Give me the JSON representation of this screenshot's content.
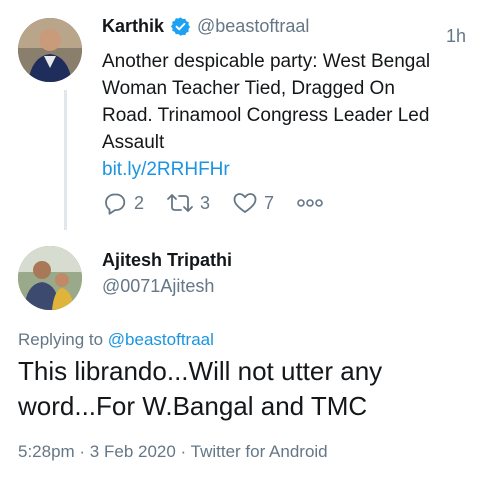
{
  "parent_tweet": {
    "author_name": "Karthik",
    "author_handle": "@beastoftraal",
    "time": "1h",
    "text": "Another despicable party: West Bengal Woman Teacher Tied, Dragged On Road. Trinamool Congress Leader Led Assault",
    "link": "bit.ly/2RRHFHr",
    "replies": "2",
    "retweets": "3",
    "likes": "7",
    "verified_color": "#1da1f2"
  },
  "reply_tweet": {
    "author_name": "Ajitesh Tripathi",
    "author_handle": "@0071Ajitesh",
    "replying_prefix": "Replying to",
    "replying_to": "@beastoftraal",
    "text": "This librando...Will not utter any word...For W.Bangal and TMC",
    "timestamp": "5:28pm · 3 Feb 2020 · Twitter for Android"
  },
  "colors": {
    "link": "#1b95e0",
    "muted": "#657786",
    "text": "#14171a"
  }
}
